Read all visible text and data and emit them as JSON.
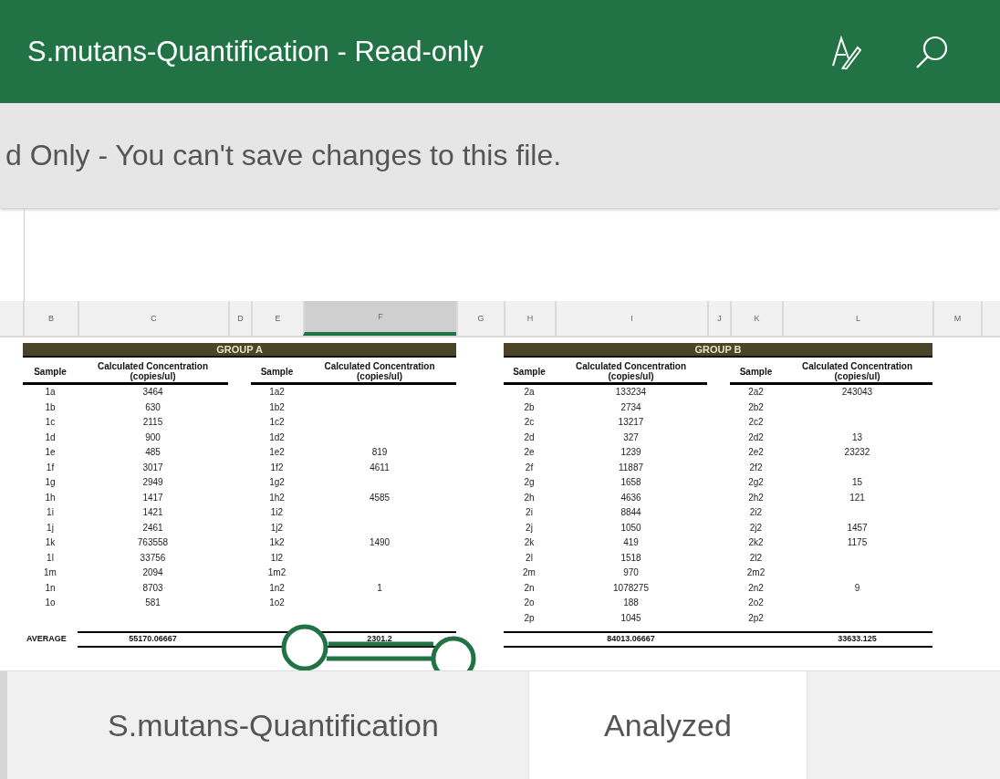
{
  "window": {
    "title": "S.mutans-Quantification - Read-only"
  },
  "banner": {
    "text": "d Only - You can't save changes to this file."
  },
  "columns": [
    {
      "label": "B",
      "selected": false
    },
    {
      "label": "C",
      "selected": false
    },
    {
      "label": "D",
      "selected": false
    },
    {
      "label": "E",
      "selected": false
    },
    {
      "label": "F",
      "selected": true
    },
    {
      "label": "G",
      "selected": false
    },
    {
      "label": "H",
      "selected": false
    },
    {
      "label": "I",
      "selected": false
    },
    {
      "label": "J",
      "selected": false
    },
    {
      "label": "K",
      "selected": false
    },
    {
      "label": "L",
      "selected": false
    },
    {
      "label": "M",
      "selected": false
    }
  ],
  "groups": [
    {
      "title": "GROUP A",
      "tables": [
        {
          "header_sample": "Sample",
          "header_value": [
            "Calculated Concentration",
            "(copies/ul)"
          ],
          "average_label": "AVERAGE",
          "average": "55170.06667",
          "rows": [
            {
              "sample": "1a",
              "value": "3464"
            },
            {
              "sample": "1b",
              "value": "630"
            },
            {
              "sample": "1c",
              "value": "2115"
            },
            {
              "sample": "1d",
              "value": "900"
            },
            {
              "sample": "1e",
              "value": "485"
            },
            {
              "sample": "1f",
              "value": "3017"
            },
            {
              "sample": "1g",
              "value": "2949"
            },
            {
              "sample": "1h",
              "value": "1417"
            },
            {
              "sample": "1i",
              "value": "1421"
            },
            {
              "sample": "1j",
              "value": "2461"
            },
            {
              "sample": "1k",
              "value": "763558"
            },
            {
              "sample": "1l",
              "value": "33756"
            },
            {
              "sample": "1m",
              "value": "2094"
            },
            {
              "sample": "1n",
              "value": "8703"
            },
            {
              "sample": "1o",
              "value": "581"
            }
          ]
        },
        {
          "header_sample": "Sample",
          "header_value": [
            "Calculated Concentration",
            "(copies/ul)"
          ],
          "average": "2301.2",
          "rows": [
            {
              "sample": "1a2"
            },
            {
              "sample": "1b2"
            },
            {
              "sample": "1c2"
            },
            {
              "sample": "1d2"
            },
            {
              "sample": "1e2",
              "value": "819"
            },
            {
              "sample": "1f2",
              "value": "4611"
            },
            {
              "sample": "1g2"
            },
            {
              "sample": "1h2",
              "value": "4585"
            },
            {
              "sample": "1i2"
            },
            {
              "sample": "1j2"
            },
            {
              "sample": "1k2",
              "value": "1490"
            },
            {
              "sample": "1l2"
            },
            {
              "sample": "1m2"
            },
            {
              "sample": "1n2",
              "value": "1"
            },
            {
              "sample": "1o2"
            }
          ]
        }
      ]
    },
    {
      "title": "GROUP B",
      "tables": [
        {
          "header_sample": "Sample",
          "header_value": [
            "Calculated Concentration",
            "(copies/ul)"
          ],
          "average": "84013.06667",
          "rows": [
            {
              "sample": "2a",
              "value": "133234"
            },
            {
              "sample": "2b",
              "value": "2734"
            },
            {
              "sample": "2c",
              "value": "13217"
            },
            {
              "sample": "2d",
              "value": "327"
            },
            {
              "sample": "2e",
              "value": "1239"
            },
            {
              "sample": "2f",
              "value": "11887"
            },
            {
              "sample": "2g",
              "value": "1658"
            },
            {
              "sample": "2h",
              "value": "4636"
            },
            {
              "sample": "2i",
              "value": "8844"
            },
            {
              "sample": "2j",
              "value": "1050"
            },
            {
              "sample": "2k",
              "value": "419"
            },
            {
              "sample": "2l",
              "value": "1518"
            },
            {
              "sample": "2m",
              "value": "970"
            },
            {
              "sample": "2n",
              "value": "1078275"
            },
            {
              "sample": "2o",
              "value": "188"
            },
            {
              "sample": "2p",
              "value": "1045"
            }
          ]
        },
        {
          "header_sample": "Sample",
          "header_value": [
            "Calculated Concentration",
            "(copies/ul)"
          ],
          "average": "33633.125",
          "rows": [
            {
              "sample": "2a2",
              "value": "243043"
            },
            {
              "sample": "2b2"
            },
            {
              "sample": "2c2"
            },
            {
              "sample": "2d2",
              "value": "13"
            },
            {
              "sample": "2e2",
              "value": "23232"
            },
            {
              "sample": "2f2"
            },
            {
              "sample": "2g2",
              "value": "15"
            },
            {
              "sample": "2h2",
              "value": "121"
            },
            {
              "sample": "2i2"
            },
            {
              "sample": "2j2",
              "value": "1457"
            },
            {
              "sample": "2k2",
              "value": "1175"
            },
            {
              "sample": "2l2"
            },
            {
              "sample": "2m2"
            },
            {
              "sample": "2n2",
              "value": "9"
            },
            {
              "sample": "2o2"
            },
            {
              "sample": "2p2"
            }
          ]
        }
      ]
    }
  ],
  "sheet_tabs": [
    {
      "label": "S.mutans-Quantification",
      "selected": false
    },
    {
      "label": "Analyzed",
      "selected": true
    }
  ]
}
